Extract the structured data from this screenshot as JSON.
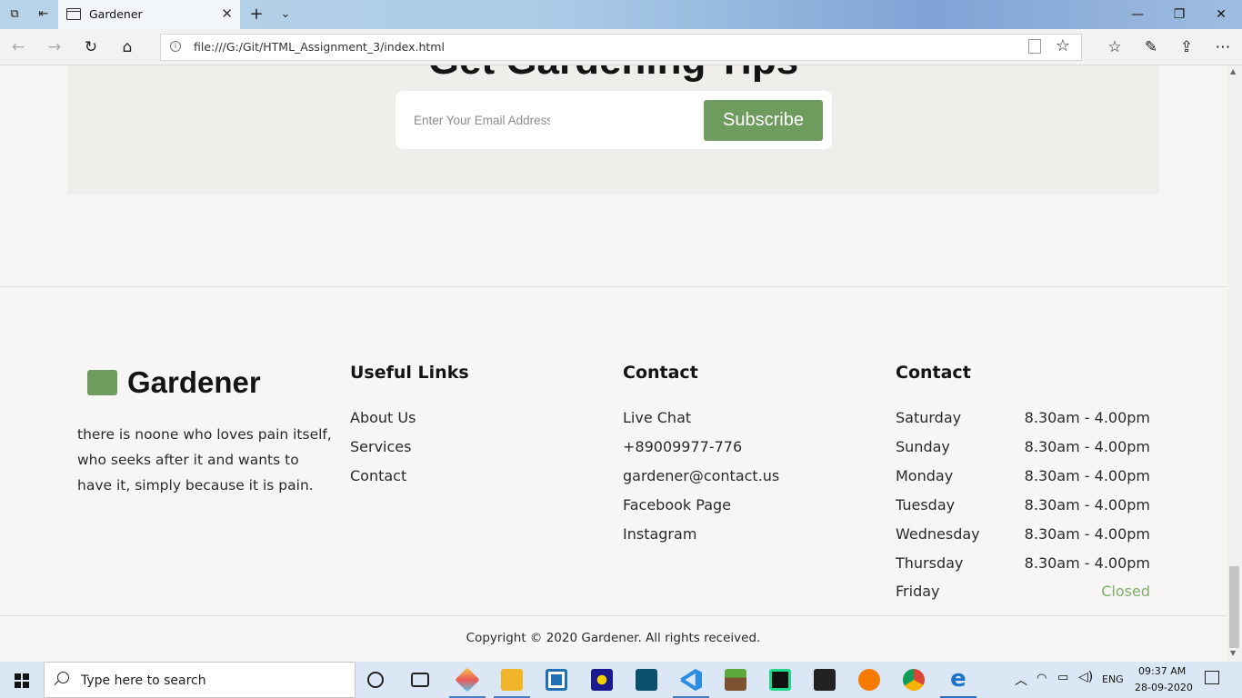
{
  "browser": {
    "tab_title": "Gardener",
    "url": "file:///G:/Git/HTML_Assignment_3/index.html"
  },
  "newsletter": {
    "title": "Get Gardening Tips",
    "email_placeholder": "Enter Your Email Address",
    "subscribe_label": "Subscribe"
  },
  "footer": {
    "brand": "Gardener",
    "about": "there is noone who loves pain itself, who seeks after it and wants to have it, simply because it is pain.",
    "useful_links": {
      "heading": "Useful Links",
      "items": [
        "About Us",
        "Services",
        "Contact"
      ]
    },
    "contact": {
      "heading": "Contact",
      "items": [
        "Live Chat",
        "+89009977-776",
        "gardener@contact.us",
        "Facebook Page",
        "Instagram"
      ]
    },
    "hours": {
      "heading": "Contact",
      "rows": [
        {
          "day": "Saturday",
          "time": "8.30am - 4.00pm"
        },
        {
          "day": "Sunday",
          "time": "8.30am - 4.00pm"
        },
        {
          "day": "Monday",
          "time": "8.30am - 4.00pm"
        },
        {
          "day": "Tuesday",
          "time": "8.30am - 4.00pm"
        },
        {
          "day": "Wednesday",
          "time": "8.30am - 4.00pm"
        },
        {
          "day": "Thursday",
          "time": "8.30am - 4.00pm"
        },
        {
          "day": "Friday",
          "time": "Closed"
        }
      ]
    },
    "copyright": "Copyright © 2020 Gardener. All rights received."
  },
  "taskbar": {
    "search_placeholder": "Type here to search",
    "language": "ENG",
    "time": "09:37 AM",
    "date": "28-09-2020"
  },
  "colors": {
    "accent_green": "#6e9c5e",
    "closed_green": "#7fae6c"
  }
}
